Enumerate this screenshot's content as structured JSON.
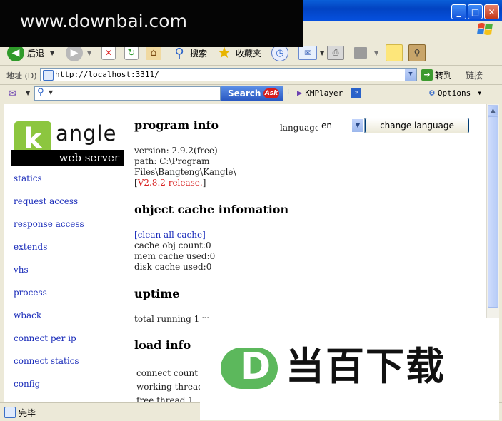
{
  "watermark_top": {
    "text": "www.downbai.com"
  },
  "window_buttons": {
    "minimize": "_",
    "maximize": "□",
    "close": "✕"
  },
  "toolbar": {
    "back_label": "后退",
    "search_label": "搜索",
    "favorites_label": "收藏夹"
  },
  "address": {
    "label": "地址 (D)",
    "url": "http://localhost:3311/",
    "go_label": "转到",
    "links_label": "链接"
  },
  "searchbar": {
    "search_button": "Search",
    "ask_badge": "Ask",
    "kmplayer_label": "KMPlayer",
    "options_label": "Options"
  },
  "page": {
    "logo": {
      "letter": "k",
      "word": "angle",
      "subtitle": "web server"
    },
    "nav": [
      "statics",
      "request access",
      "response access",
      "extends",
      "vhs",
      "process",
      "wback",
      "connect per ip",
      "connect statics",
      "config"
    ],
    "program_info": {
      "title": "program info",
      "version": "version: 2.9.2(free)",
      "path1": "path: C:\\Program",
      "path2": "Files\\Bangteng\\Kangle\\",
      "release_open": "[",
      "release": "V2.8.2 release.",
      "release_close": "]"
    },
    "language": {
      "label": "language:",
      "selected": "en",
      "button": "change language"
    },
    "object_cache": {
      "title": "object cache infomation",
      "clear_link": "[clean all cache]",
      "obj_count": "cache obj count:0",
      "mem_used": "mem cache used:0",
      "disk_used": "disk cache used:0"
    },
    "uptime": {
      "title": "uptime",
      "text": "total running 1 m"
    },
    "load_info": {
      "title": "load info",
      "rows": [
        "connect count  2",
        "working thread 8",
        "free thread      1"
      ]
    }
  },
  "watermark_bottom": {
    "letter": "D",
    "text": "当百下载"
  },
  "statusbar": {
    "text": "完毕"
  }
}
